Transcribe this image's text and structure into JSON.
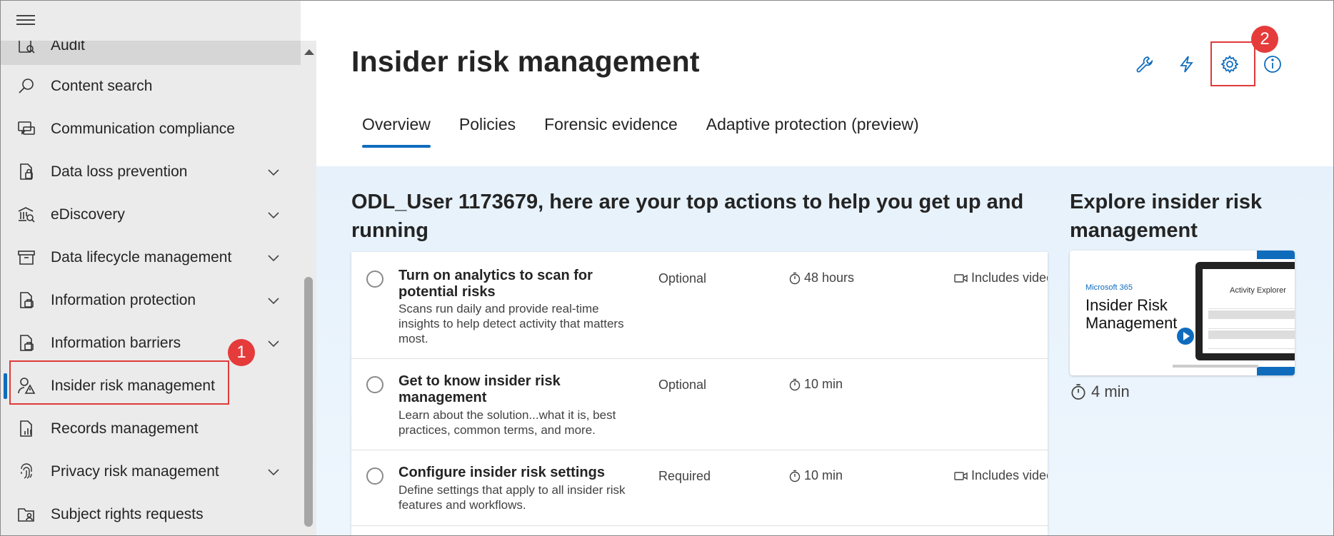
{
  "sidebar": {
    "items": [
      {
        "label": "Audit",
        "icon": "audit-icon",
        "chevron": false
      },
      {
        "label": "Content search",
        "icon": "search-icon",
        "chevron": false
      },
      {
        "label": "Communication compliance",
        "icon": "chat-icon",
        "chevron": false
      },
      {
        "label": "Data loss prevention",
        "icon": "lock-document-icon",
        "chevron": true
      },
      {
        "label": "eDiscovery",
        "icon": "bank-search-icon",
        "chevron": true
      },
      {
        "label": "Data lifecycle management",
        "icon": "archive-icon",
        "chevron": true
      },
      {
        "label": "Information protection",
        "icon": "document-briefcase-icon",
        "chevron": true
      },
      {
        "label": "Information barriers",
        "icon": "document-briefcase-icon",
        "chevron": true
      },
      {
        "label": "Insider risk management",
        "icon": "person-warning-icon",
        "chevron": false
      },
      {
        "label": "Records management",
        "icon": "chart-document-icon",
        "chevron": false
      },
      {
        "label": "Privacy risk management",
        "icon": "fingerprint-icon",
        "chevron": true
      },
      {
        "label": "Subject rights requests",
        "icon": "folder-person-icon",
        "chevron": false
      }
    ]
  },
  "header": {
    "title": "Insider risk management",
    "icons": [
      "wrench-icon",
      "flash-icon",
      "gear-icon",
      "info-icon"
    ]
  },
  "tabs": [
    {
      "label": "Overview",
      "active": true
    },
    {
      "label": "Policies",
      "active": false
    },
    {
      "label": "Forensic evidence",
      "active": false
    },
    {
      "label": "Adaptive protection (preview)",
      "active": false
    }
  ],
  "actions": {
    "heading": "ODL_User 1173679, here are your top actions to help you get up and running",
    "rows": [
      {
        "title": "Turn on analytics to scan for potential risks",
        "description": "Scans run daily and provide real-time insights to help detect activity that matters most.",
        "requirement": "Optional",
        "time": "48 hours",
        "video": "Includes video tutor"
      },
      {
        "title": "Get to know insider risk management",
        "description": "Learn about the solution...what it is, best practices, common terms, and more.",
        "requirement": "Optional",
        "time": "10 min",
        "video": ""
      },
      {
        "title": "Configure insider risk settings",
        "description": "Define settings that apply to all insider risk features and workflows.",
        "requirement": "Required",
        "time": "10 min",
        "video": "Includes video tutor"
      }
    ]
  },
  "explore": {
    "heading": "Explore insider risk management",
    "video_brand": "Microsoft 365",
    "video_title": "Insider Risk Management",
    "video_screen_title": "Activity Explorer",
    "duration": "4 min"
  },
  "annotations": {
    "badge1": "1",
    "badge2": "2"
  },
  "colors": {
    "accent": "#0f6cbd",
    "annotation": "#e03a3a",
    "sidebar_bg": "#ebebeb",
    "content_bg": "#e6f1fb"
  }
}
